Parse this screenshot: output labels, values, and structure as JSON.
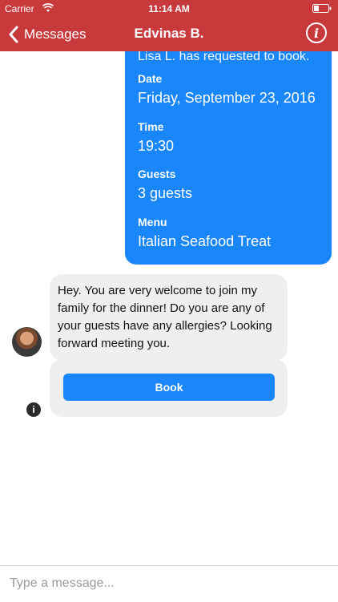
{
  "status_bar": {
    "carrier": "Carrier",
    "time": "11:14 AM",
    "wifi_icon": "wifi-icon",
    "battery_icon": "battery-icon"
  },
  "nav": {
    "back_label": "Messages",
    "title": "Edvinas B.",
    "back_icon": "chevron-left-icon",
    "info_icon": "info-icon",
    "info_glyph": "i"
  },
  "booking_message": {
    "clipped_text": "Lisa L. has requested to book.",
    "fields": [
      {
        "label": "Date",
        "value": "Friday, September 23, 2016"
      },
      {
        "label": "Time",
        "value": "19:30"
      },
      {
        "label": "Guests",
        "value": "3 guests"
      },
      {
        "label": "Menu",
        "value": "Italian Seafood Treat"
      }
    ]
  },
  "reply_message": {
    "text": "Hey. You are very welcome to join my family for the dinner! Do you are any of your guests have any allergies? Looking forward meeting you."
  },
  "book_card": {
    "button_label": "Book",
    "info_glyph": "i"
  },
  "composer": {
    "placeholder": "Type a message..."
  },
  "colors": {
    "nav_red": "#c8393c",
    "bubble_blue": "#1a86fb",
    "bubble_gray": "#efefef"
  }
}
